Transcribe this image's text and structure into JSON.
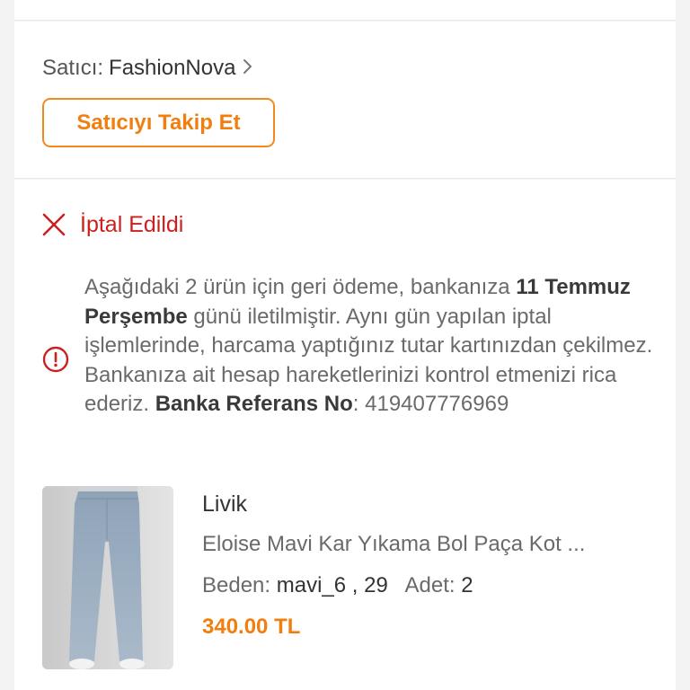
{
  "seller": {
    "label": "Satıcı:",
    "name": "FashionNova",
    "follow_button": "Satıcıyı Takip Et"
  },
  "order": {
    "status": "İptal Edildi",
    "refund": {
      "part1": "Aşağıdaki 2 ürün için geri ödeme, bankanıza ",
      "date": "11 Temmuz Perşembe",
      "part2": " günü iletilmiştir. Aynı gün yapılan iptal işlemlerinde, harcama yaptığınız tutar kartınızdan çekilmez. Bankanıza ait hesap hareketlerinizi kontrol etmenizi rica ederiz. ",
      "ref_label": "Banka Referans No",
      "ref_sep": ": ",
      "ref_number": "419407776969"
    },
    "product": {
      "brand": "Livik",
      "title": "Eloise Mavi Kar Yıkama Bol Paça Kot ...",
      "size_label": "Beden:",
      "size_value": "mavi_6 , 29",
      "qty_label": "Adet:",
      "qty_value": "2",
      "price": "340.00 TL"
    }
  },
  "colors": {
    "accent": "#f07f10",
    "cancel_red": "#cc1f1f"
  },
  "icons": {
    "seller_chevron": "chevron-right-icon",
    "status": "close-icon",
    "info": "info-icon"
  }
}
